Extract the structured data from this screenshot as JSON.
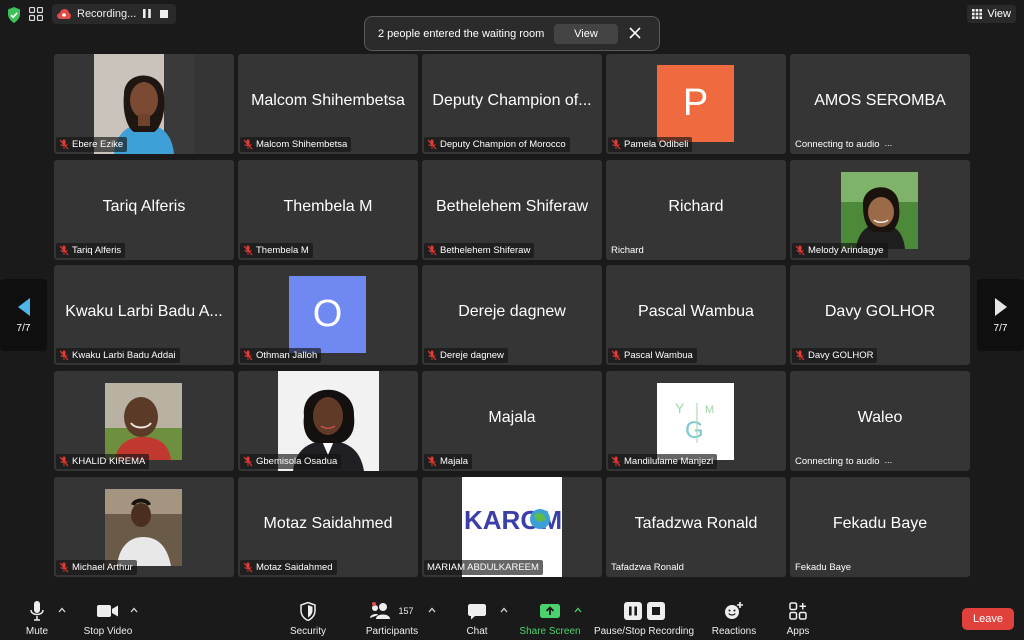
{
  "topbar": {
    "recording_label": "Recording...",
    "view_label": "View"
  },
  "notification": {
    "text": "2 people entered the waiting room",
    "view_button": "View"
  },
  "pager": {
    "left_label": "7/7",
    "right_label": "7/7"
  },
  "tiles": [
    {
      "label": "Ebere Ezike",
      "muted": true,
      "kind": "photo"
    },
    {
      "label": "Malcom Shihembetsa",
      "name": "Malcom Shihembetsa",
      "muted": true
    },
    {
      "label": "Deputy Champion of Morocco",
      "name": "Deputy Champion of...",
      "muted": true
    },
    {
      "label": "Pamela Odibeli",
      "initial": "P",
      "muted": true,
      "color": "#ef6a3f"
    },
    {
      "label": "Connecting to audio",
      "name": "AMOS SEROMBA",
      "muted": false,
      "connecting": true
    },
    {
      "label": "Tariq Alferis",
      "name": "Tariq Alferis",
      "muted": true
    },
    {
      "label": "Thembela M",
      "name": "Thembela M",
      "muted": true
    },
    {
      "label": "Bethelehem Shiferaw",
      "name": "Bethelehem Shiferaw",
      "muted": true
    },
    {
      "label": "Richard",
      "name": "Richard",
      "muted": false
    },
    {
      "label": "Melody Arindagye",
      "muted": true,
      "kind": "photo"
    },
    {
      "label": "Kwaku Larbi Badu Addai",
      "name": "Kwaku Larbi Badu A...",
      "muted": true
    },
    {
      "label": "Othman Jalloh",
      "initial": "O",
      "muted": true,
      "color": "#6f88f2"
    },
    {
      "label": "Dereje dagnew",
      "name": "Dereje dagnew",
      "muted": true
    },
    {
      "label": "Pascal Wambua",
      "name": "Pascal Wambua",
      "muted": true
    },
    {
      "label": "Davy GOLHOR",
      "name": "Davy GOLHOR",
      "muted": true
    },
    {
      "label": "KHALID KIREMA",
      "muted": true,
      "kind": "photo"
    },
    {
      "label": "Gbemisola Osadua",
      "muted": true,
      "kind": "photo"
    },
    {
      "label": "Majala",
      "name": "Majala",
      "muted": true
    },
    {
      "label": "Mandilulame Manjezi",
      "muted": true,
      "kind": "logo"
    },
    {
      "label": "Connecting to audio",
      "name": "Waleo",
      "muted": false,
      "connecting": true
    },
    {
      "label": "Michael Arthur",
      "muted": true,
      "kind": "photo"
    },
    {
      "label": "Motaz Saidahmed",
      "name": "Motaz Saidahmed",
      "muted": true
    },
    {
      "label": "MARIAM ABDULKAREEM",
      "muted": false,
      "kind": "logo",
      "logo_text": "KAROM"
    },
    {
      "label": "Tafadzwa Ronald",
      "name": "Tafadzwa Ronald",
      "muted": false
    },
    {
      "label": "Fekadu Baye",
      "name": "Fekadu Baye",
      "muted": false
    }
  ],
  "logo_mandilulame": {
    "letters": [
      "Y",
      "M",
      "G"
    ]
  },
  "toolbar": {
    "mute": "Mute",
    "stop_video": "Stop Video",
    "security": "Security",
    "participants": "Participants",
    "participants_count": "157",
    "chat": "Chat",
    "share_screen": "Share Screen",
    "pause_stop_recording": "Pause/Stop Recording",
    "reactions": "Reactions",
    "apps": "Apps",
    "leave": "Leave"
  },
  "colors": {
    "accent_green": "#4cd26c",
    "leave_red": "#e0413b",
    "security_green": "#3ec15a"
  }
}
